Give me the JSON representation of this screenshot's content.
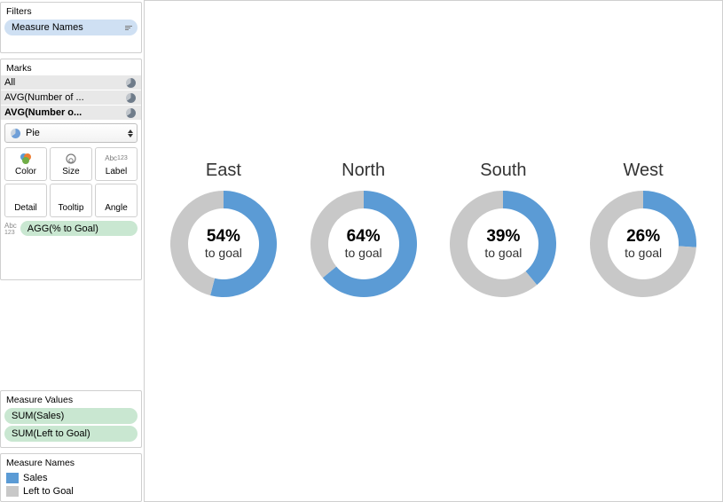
{
  "colors": {
    "sales": "#5b9bd5",
    "left_to_goal": "#c8c8c8"
  },
  "sidebar": {
    "filters": {
      "title": "Filters",
      "pill": "Measure Names"
    },
    "marks": {
      "title": "Marks",
      "rows": [
        {
          "label": "All"
        },
        {
          "label": "AVG(Number of ..."
        },
        {
          "label": "AVG(Number o...",
          "bold": true
        }
      ],
      "mark_type": "Pie",
      "shelves": [
        {
          "name": "Color"
        },
        {
          "name": "Size"
        },
        {
          "name": "Label"
        },
        {
          "name": "Detail"
        },
        {
          "name": "Tooltip"
        },
        {
          "name": "Angle"
        }
      ],
      "agg_pill": "AGG(% to Goal)"
    },
    "measure_values": {
      "title": "Measure Values",
      "pills": [
        "SUM(Sales)",
        "SUM(Left to Goal)"
      ]
    },
    "legend": {
      "title": "Measure Names",
      "items": [
        {
          "label": "Sales",
          "color": "#5b9bd5"
        },
        {
          "label": "Left to Goal",
          "color": "#c8c8c8"
        }
      ]
    }
  },
  "chart_data": {
    "type": "pie",
    "title": "",
    "subtitle_each": "to goal",
    "series": [
      {
        "name": "Sales",
        "color": "#5b9bd5"
      },
      {
        "name": "Left to Goal",
        "color": "#c8c8c8"
      }
    ],
    "regions": [
      {
        "region": "East",
        "pct_to_goal": 54
      },
      {
        "region": "North",
        "pct_to_goal": 64
      },
      {
        "region": "South",
        "pct_to_goal": 39
      },
      {
        "region": "West",
        "pct_to_goal": 26
      }
    ]
  }
}
